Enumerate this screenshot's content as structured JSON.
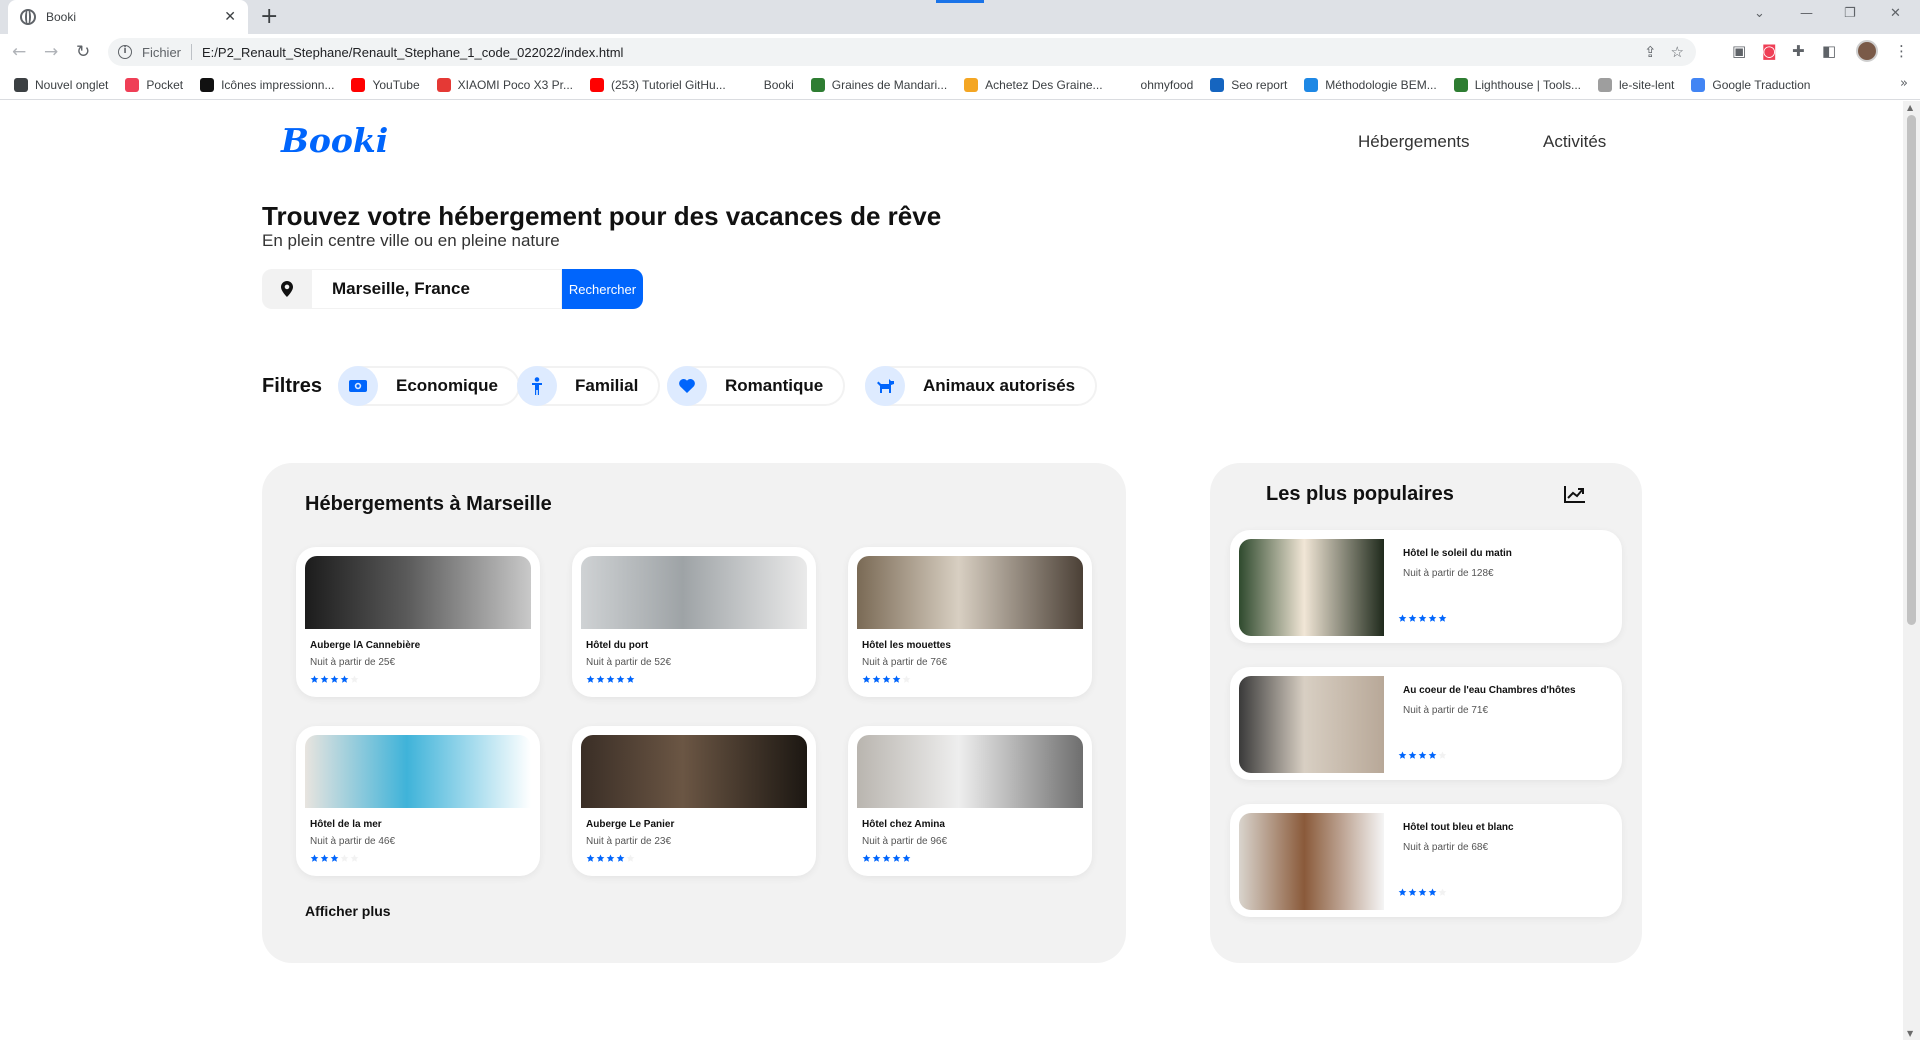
{
  "browser": {
    "tab_title": "Booki",
    "tab_close": "✕",
    "new_tab": "+",
    "scheme_label": "Fichier",
    "url": "E:/P2_Renault_Stephane/Renault_Stephane_1_code_022022/index.html",
    "bookmarks": [
      {
        "label": "Nouvel onglet",
        "color": "#3c4043"
      },
      {
        "label": "Pocket",
        "color": "#ef3f56"
      },
      {
        "label": "Icônes impressionn...",
        "color": "#111111"
      },
      {
        "label": "YouTube",
        "color": "#ff0000"
      },
      {
        "label": "XIAOMI Poco X3 Pr...",
        "color": "#e53935"
      },
      {
        "label": "(253) Tutoriel GitHu...",
        "color": "#ff0000"
      },
      {
        "label": "Booki",
        "color": "#ffffff"
      },
      {
        "label": "Graines de Mandari...",
        "color": "#2e7d32"
      },
      {
        "label": "Achetez Des Graine...",
        "color": "#f4a623"
      },
      {
        "label": "ohmyfood",
        "color": "#ffffff"
      },
      {
        "label": "Seo report",
        "color": "#1565c0"
      },
      {
        "label": "Méthodologie BEM...",
        "color": "#1e88e5"
      },
      {
        "label": "Lighthouse | Tools...",
        "color": "#2e7d32"
      },
      {
        "label": "le-site-lent",
        "color": "#9e9e9e"
      },
      {
        "label": "Google Traduction",
        "color": "#4285f4"
      }
    ],
    "bookmarks_more": "»"
  },
  "site": {
    "logo": "Booki",
    "nav": [
      "Hébergements",
      "Activités"
    ],
    "title": "Trouvez votre hébergement pour des vacances de rêve",
    "subtitle": "En plein centre ville ou en pleine nature",
    "search": {
      "value": "Marseille, France",
      "button": "Rechercher"
    },
    "filters_label": "Filtres",
    "filters": [
      {
        "label": "Economique",
        "icon": "money-icon"
      },
      {
        "label": "Familial",
        "icon": "child-icon"
      },
      {
        "label": "Romantique",
        "icon": "heart-icon"
      },
      {
        "label": "Animaux autorisés",
        "icon": "dog-icon"
      }
    ],
    "accent": "#0065fc"
  },
  "listings": {
    "title": "Hébergements à Marseille",
    "more": "Afficher plus",
    "items": [
      {
        "name": "Auberge lA Cannebière",
        "price": "Nuit à partir de 25€",
        "rating": 4
      },
      {
        "name": "Hôtel du port",
        "price": "Nuit à partir de 52€",
        "rating": 5
      },
      {
        "name": "Hôtel les mouettes",
        "price": "Nuit à partir de 76€",
        "rating": 4
      },
      {
        "name": "Hôtel de la mer",
        "price": "Nuit à partir de 46€",
        "rating": 3
      },
      {
        "name": "Auberge Le Panier",
        "price": "Nuit à partir de 23€",
        "rating": 4
      },
      {
        "name": "Hôtel chez Amina",
        "price": "Nuit à partir de 96€",
        "rating": 5
      }
    ]
  },
  "popular": {
    "title": "Les plus populaires",
    "items": [
      {
        "name": "Hôtel le soleil du matin",
        "price": "Nuit à partir de 128€",
        "rating": 5
      },
      {
        "name": "Au coeur de l'eau Chambres d'hôtes",
        "price": "Nuit à partir de 71€",
        "rating": 4
      },
      {
        "name": "Hôtel tout bleu et blanc",
        "price": "Nuit à partir de 68€",
        "rating": 4
      }
    ]
  }
}
